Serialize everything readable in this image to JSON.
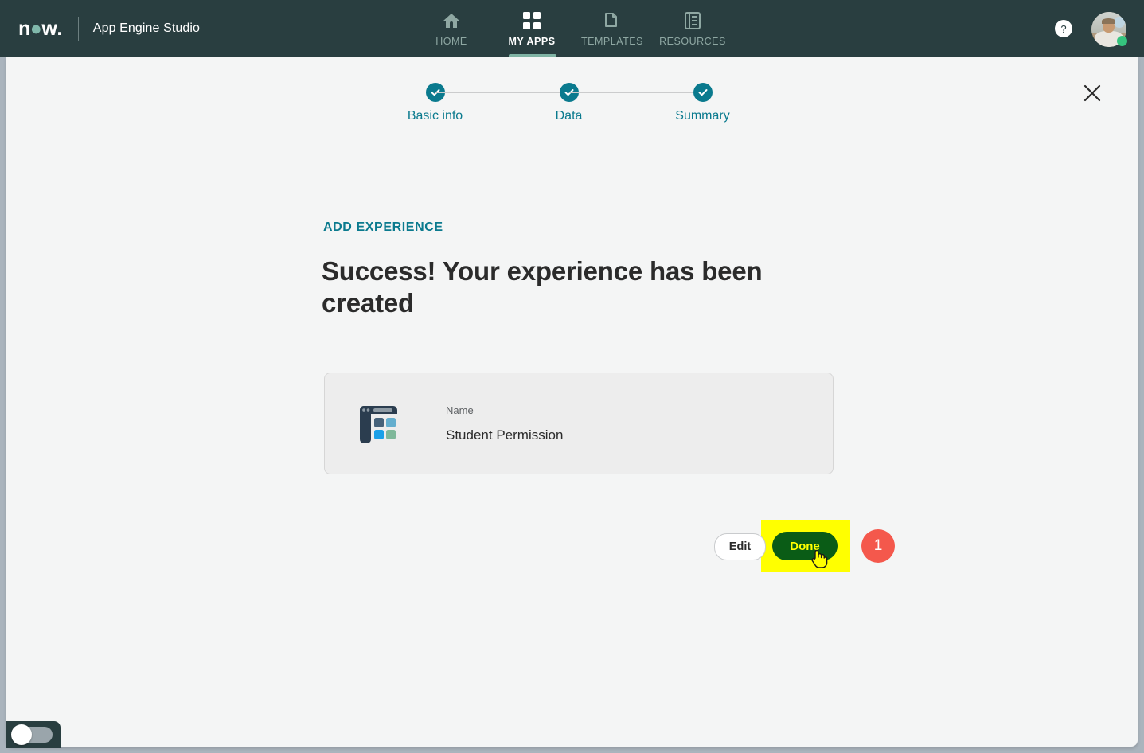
{
  "topnav": {
    "logo_text": "now",
    "product_title": "App Engine Studio",
    "tabs": [
      {
        "label": "HOME",
        "icon": "home-icon",
        "active": false
      },
      {
        "label": "MY APPS",
        "icon": "grid-icon",
        "active": true
      },
      {
        "label": "TEMPLATES",
        "icon": "templates-icon",
        "active": false
      },
      {
        "label": "RESOURCES",
        "icon": "resources-icon",
        "active": false
      }
    ],
    "help_label": "?",
    "help_icon": "help-icon",
    "avatar_icon": "user-avatar"
  },
  "modal": {
    "close_icon": "close-icon",
    "stepper": [
      {
        "label": "Basic info",
        "state": "complete"
      },
      {
        "label": "Data",
        "state": "complete"
      },
      {
        "label": "Summary",
        "state": "complete"
      }
    ],
    "eyebrow": "ADD EXPERIENCE",
    "headline": "Success! Your experience has been created",
    "card": {
      "icon": "experience-portal-icon",
      "field_label": "Name",
      "field_value": "Student Permission"
    },
    "actions": {
      "edit_label": "Edit",
      "done_label": "Done",
      "step_badge": "1"
    }
  },
  "footer": {
    "toggle_name": "theme-toggle",
    "toggle_state": "off"
  },
  "colors": {
    "nav_background": "#293e40",
    "accent_teal": "#0a7a8e",
    "logo_teal": "#80b8ab",
    "active_underline": "#7fb3a4",
    "panel_background": "#f4f5f5",
    "card_background": "#ededed",
    "done_button": "#0a5c16",
    "done_text": "#ffff00",
    "highlight": "#ffff00",
    "badge": "#f4584c",
    "page_frame": "#aab4bd"
  }
}
